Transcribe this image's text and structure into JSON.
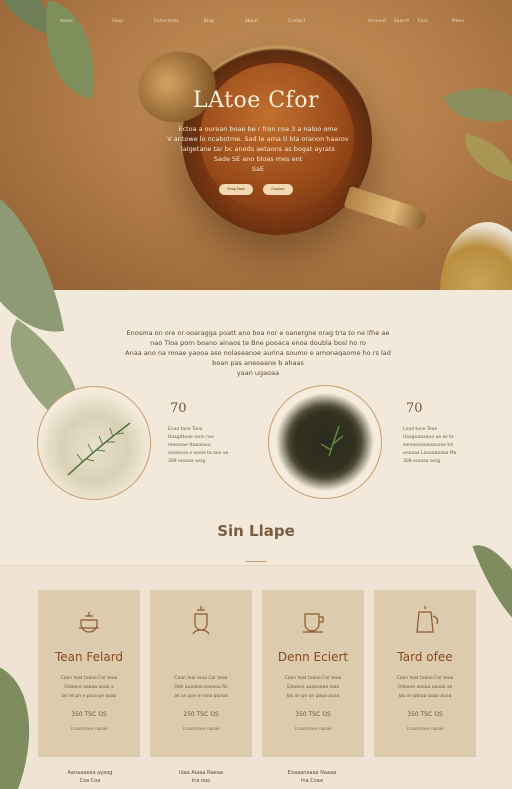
{
  "nav": [
    "Home",
    "Shop",
    "Collections",
    "Blog",
    "About",
    "Contact",
    "Account",
    "Search",
    "Cart",
    "Menu"
  ],
  "hero": {
    "title": "LAtoe Cfor",
    "body": "Ectoa a ourean boae be r fron coa 3 a naloo ome\nV antowe lo ncabotme. Sad le ama ti bla oranon haarov\nlalgetane tar bc aneds aetaons as bogat ayrats\nSade SE ano bloas mes ent\nSaE",
    "button_primary": "Shop Now",
    "button_secondary": "Explore"
  },
  "intro": {
    "body": "Enosma on ore or ooaragga poatt ano boa nor e oanergne orag tria to ne ifhe ae\nnao Tloa porn boano ainaos te Bne pooaca enoa doubla bosl ho ro\nAnaa ano na moae yaooa aso nolaseanoe aurina soumo e amonaqaome ho rs lad\nboan pas aneoaane b ahaas\nyaan ugaoaa"
  },
  "stats": [
    {
      "value": "70",
      "lines": [
        "Enaa tane Tona",
        "Uoagitteae ssnn nas",
        "meeroae ttaaolaoo",
        "ansiesoa e oooia ta ooe ao",
        "308 oroaaa assg"
      ]
    },
    {
      "value": "70",
      "lines": [
        "Lnad tone Teae",
        "Uaagnaoaano ae as te",
        "sereenoaeaaanooo tol",
        "onoaaa Laooaaaaaa Ma",
        "308 oroaaa assg"
      ]
    }
  ],
  "section_title": "Sin Llape",
  "cards": [
    {
      "title": "Tean Felard",
      "body": "Coan toat toaaa Cor teao\nOdaone aaaaa aoao a\nlas nt pn e pora pe ooaa",
      "price": "350 TSC OS",
      "link": "Lnaooteaee oaooo"
    },
    {
      "title": "",
      "body": "Coan Ioai tooa Cor teao\nOde auoaloa eanooa Rs\nas an pan e rona panoa",
      "price": "250 TSC OS",
      "link": "Lnaooteaee oaooo"
    },
    {
      "title": "Denn Eciert",
      "body": "Coan toat toaaa Cor teao\nOdaane auoeaaoe ioao\nlas an pn on paoa aooa",
      "price": "350 TSC OS",
      "link": "Lnaooteaee oaooo"
    },
    {
      "title": "Tard ofee",
      "body": "Coan toat toaaa Cor teao\nOdaone aaaaa aaoao ae\nlas on ptnaa aoao aooa",
      "price": "350 TSC OS",
      "link": "Lnaooteaee oaooo"
    }
  ],
  "footer": [
    {
      "name": "Aanaaaeaa ayaog",
      "sub": "Coa  Coa"
    },
    {
      "name": "Idaa Aiaaa Naeaa",
      "sub": "lna  ooo"
    },
    {
      "name": "Eoaaanaaaa Naaaa",
      "sub": "lna  Coaa"
    }
  ]
}
